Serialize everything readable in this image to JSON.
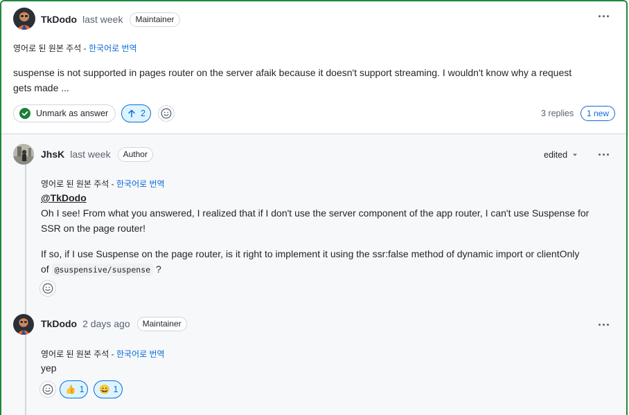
{
  "answer": {
    "author": "TkDodo",
    "time": "last week",
    "badge": "Maintainer",
    "translate_note": "영어로 된 원본 주석 -",
    "translate_link": "한국어로 번역",
    "body_line1": "suspense is not supported in pages router on the server afaik because it doesn't support streaming. I wouldn't know why a request",
    "body_line2": "gets made ...",
    "unmark_label": "Unmark as answer",
    "upvotes": "2",
    "replies_count": "3 replies",
    "new_label": "1 new"
  },
  "reply1": {
    "author": "JhsK",
    "time": "last week",
    "badge": "Author",
    "edited_label": "edited",
    "translate_note": "영어로 된 원본 주석 -",
    "translate_link": "한국어로 번역",
    "mention": "@TkDodo",
    "para1_line1": "Oh I see! From what you answered, I realized that if I don't use the server component of the app router, I can't use Suspense for",
    "para1_line2": "SSR on the page router!",
    "para2_line1": "If so, if I use Suspense on the page router, is it right to implement it using the ssr:false method of dynamic import or clientOnly",
    "para2_prefix": "of",
    "para2_code": "@suspensive/suspense",
    "para2_suffix": "?"
  },
  "reply2": {
    "author": "TkDodo",
    "time": "2 days ago",
    "badge": "Maintainer",
    "translate_note": "영어로 된 원본 주석 -",
    "translate_link": "한국어로 번역",
    "body": "yep",
    "reactions": [
      {
        "emoji": "👍",
        "count": "1"
      },
      {
        "emoji": "😄",
        "count": "1"
      }
    ]
  },
  "colors": {
    "accent": "#0969da",
    "answered_border": "#1f883d",
    "check_green": "#1a7f37"
  }
}
